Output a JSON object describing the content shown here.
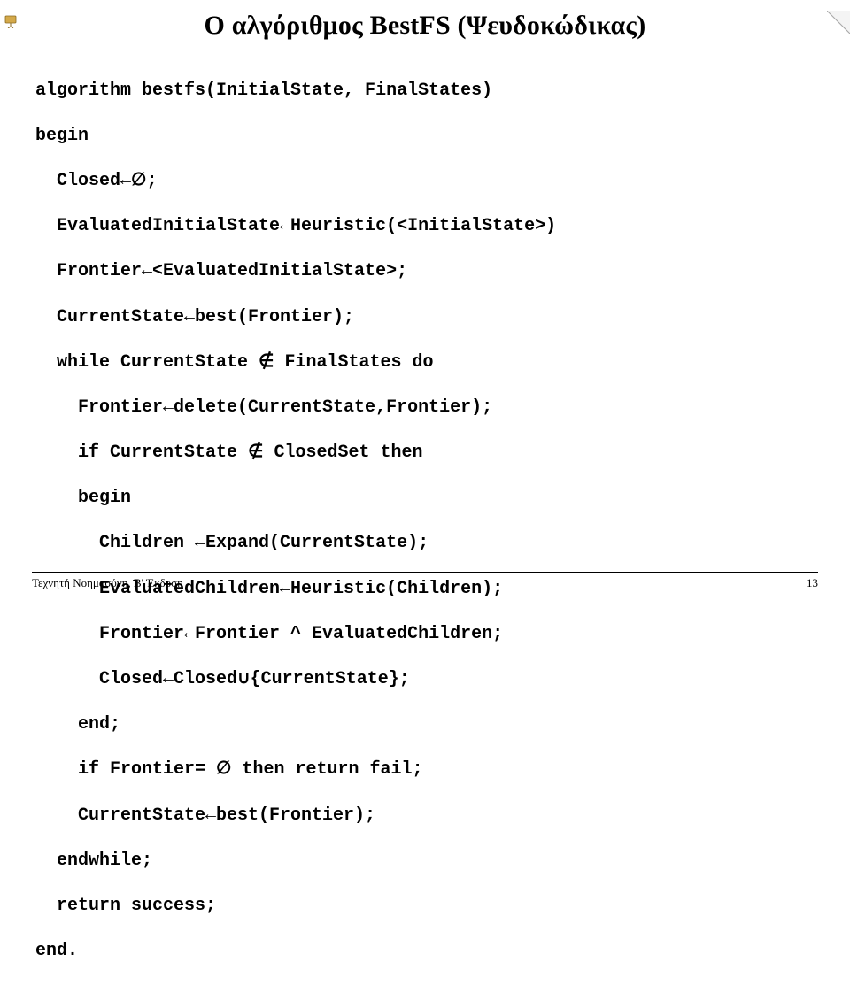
{
  "title": "Ο αλγόριθμος BestFS (Ψευδοκώδικας)",
  "code": {
    "l1": "algorithm bestfs(InitialState, FinalStates)",
    "l2": "begin",
    "l3": "  Closed←∅;",
    "l4": "  EvaluatedInitialState←Heuristic(<InitialState>)",
    "l5": "  Frontier←<EvaluatedInitialState>;",
    "l6": "  CurrentState←best(Frontier);",
    "l7": "  while CurrentState ∉ FinalStates do",
    "l8": "    Frontier←delete(CurrentState,Frontier);",
    "l9": "    if CurrentState ∉ ClosedSet then",
    "l10": "    begin",
    "l11": "      Children ←Expand(CurrentState);",
    "l12": "      EvaluatedChildren←Heuristic(Children);",
    "l13": "      Frontier←Frontier ^ EvaluatedChildren;",
    "l14": "      Closed←Closed∪{CurrentState};",
    "l15": "    end;",
    "l16": "    if Frontier= ∅ then return fail;",
    "l17": "    CurrentState←best(Frontier);",
    "l18": "  endwhile;",
    "l19": "  return success;",
    "l20": "end."
  },
  "footer": {
    "left": "Τεχνητή Νοημοσύνη, B' Έκδοση",
    "right": "13"
  }
}
